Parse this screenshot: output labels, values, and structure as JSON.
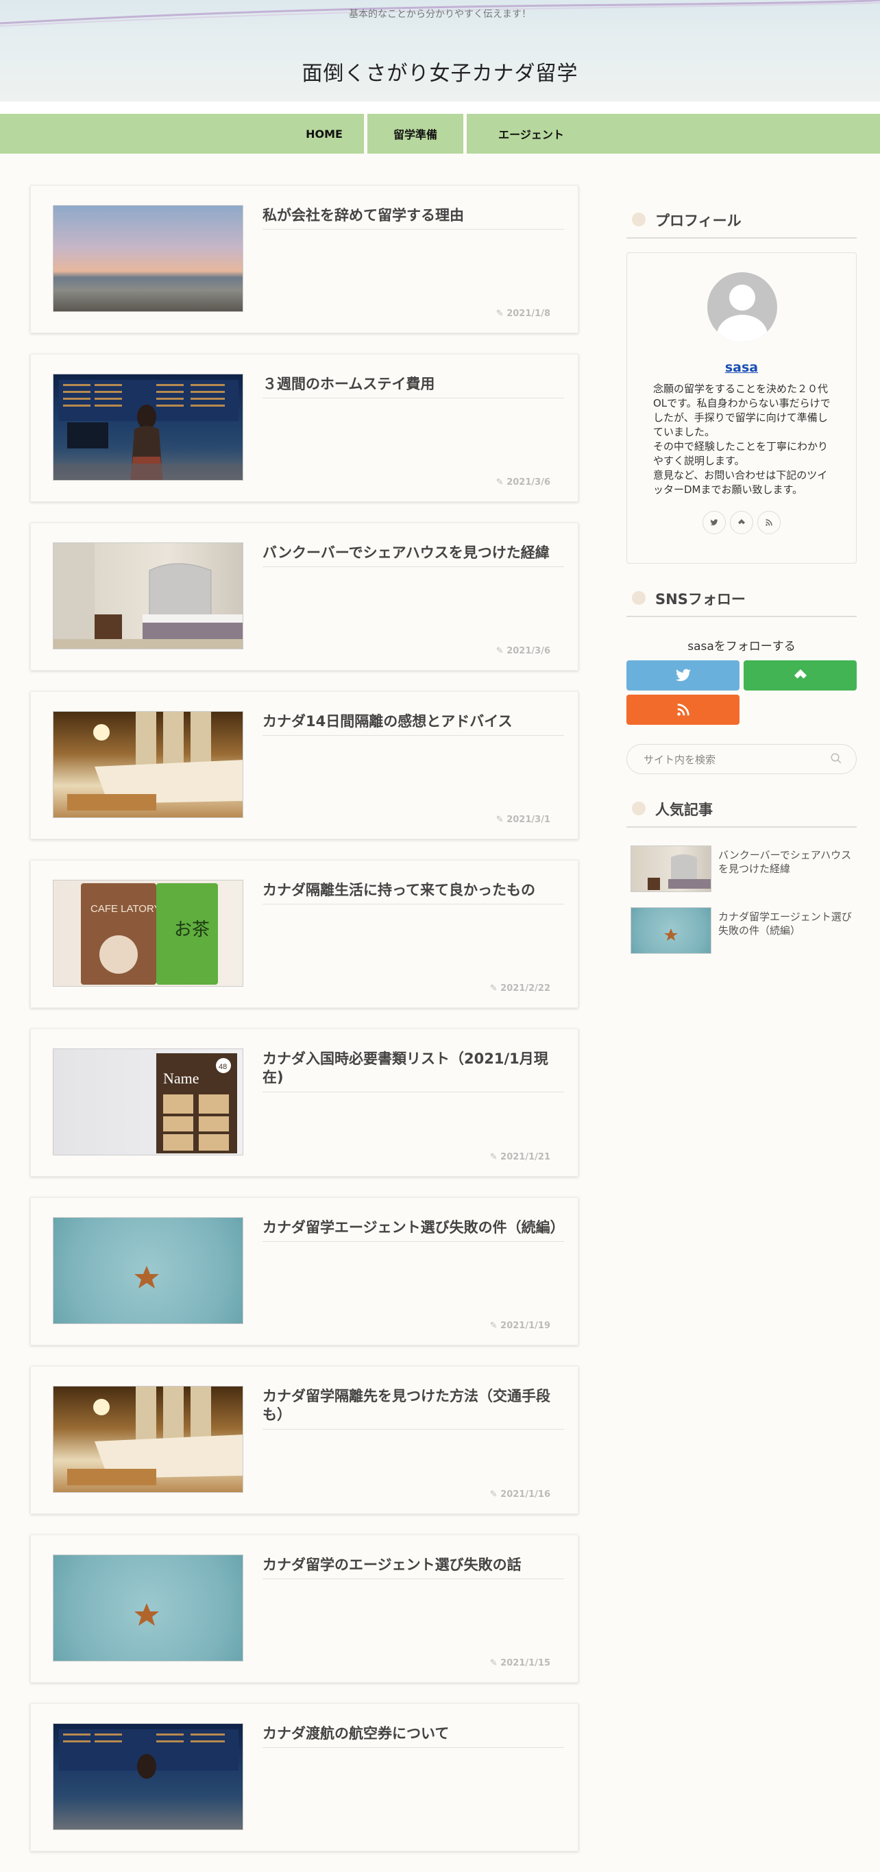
{
  "header": {
    "tagline": "基本的なことから分かりやすく伝えます！",
    "site_title": "面倒くさがり女子カナダ留学"
  },
  "nav": {
    "items": [
      "HOME",
      "留学準備",
      "エージェント"
    ]
  },
  "posts": [
    {
      "title": "私が会社を辞めて留学する理由",
      "date": "2021/1/8",
      "thumb": "beach"
    },
    {
      "title": "３週間のホームステイ費用",
      "date": "2021/3/6",
      "thumb": "airport"
    },
    {
      "title": "バンクーバーでシェアハウスを見つけた経緯",
      "date": "2021/3/6",
      "thumb": "room"
    },
    {
      "title": "カナダ14日間隔離の感想とアドバイス",
      "date": "2021/3/1",
      "thumb": "hotel"
    },
    {
      "title": "カナダ隔離生活に持って来て良かったもの",
      "date": "2021/2/22",
      "thumb": "tea"
    },
    {
      "title": "カナダ入国時必要書類リスト（2021/1月現在)",
      "date": "2021/1/21",
      "thumb": "name"
    },
    {
      "title": "カナダ留学エージェント選び失敗の件（続編）",
      "date": "2021/1/19",
      "thumb": "sea"
    },
    {
      "title": "カナダ留学隔離先を見つけた方法（交通手段も）",
      "date": "2021/1/16",
      "thumb": "hotel"
    },
    {
      "title": "カナダ留学のエージェント選び失敗の話",
      "date": "2021/1/15",
      "thumb": "sea"
    },
    {
      "title": "カナダ渡航の航空券について",
      "date": "",
      "thumb": "airport"
    }
  ],
  "thumb_texts": {
    "tea_brand": "CAFE LATORY",
    "tea_kanji": "お茶",
    "name_label": "Name",
    "name_count": "48"
  },
  "sidebar": {
    "profile_heading": "プロフィール",
    "profile_name": "sasa",
    "profile_desc": "念願の留学をすることを決めた２０代OLです。私自身わからない事だらけでしたが、手探りで留学に向けて準備していました。\nその中で経験したことを丁寧にわかりやすく説明します。\n意見など、お問い合わせは下記のツイッターDMまでお願い致します。",
    "sns_heading": "SNSフォロー",
    "follow_text": "sasaをフォローする",
    "search_placeholder": "サイト内を検索",
    "popular_heading": "人気記事",
    "popular": [
      {
        "title": "バンクーバーでシェアハウスを見つけた経緯",
        "thumb": "room"
      },
      {
        "title": "カナダ留学エージェント選び失敗の件（続編）",
        "thumb": "sea"
      }
    ]
  },
  "colors": {
    "nav_bg": "#b6d79d",
    "twitter": "#6ab0dc",
    "feedly": "#43b454",
    "rss": "#f26b2b",
    "profile_link": "#1a4fb4"
  },
  "icons": {
    "date": "pencil-icon",
    "twitter": "twitter-icon",
    "feedly": "feedly-icon",
    "rss": "rss-icon",
    "search": "search-icon"
  }
}
